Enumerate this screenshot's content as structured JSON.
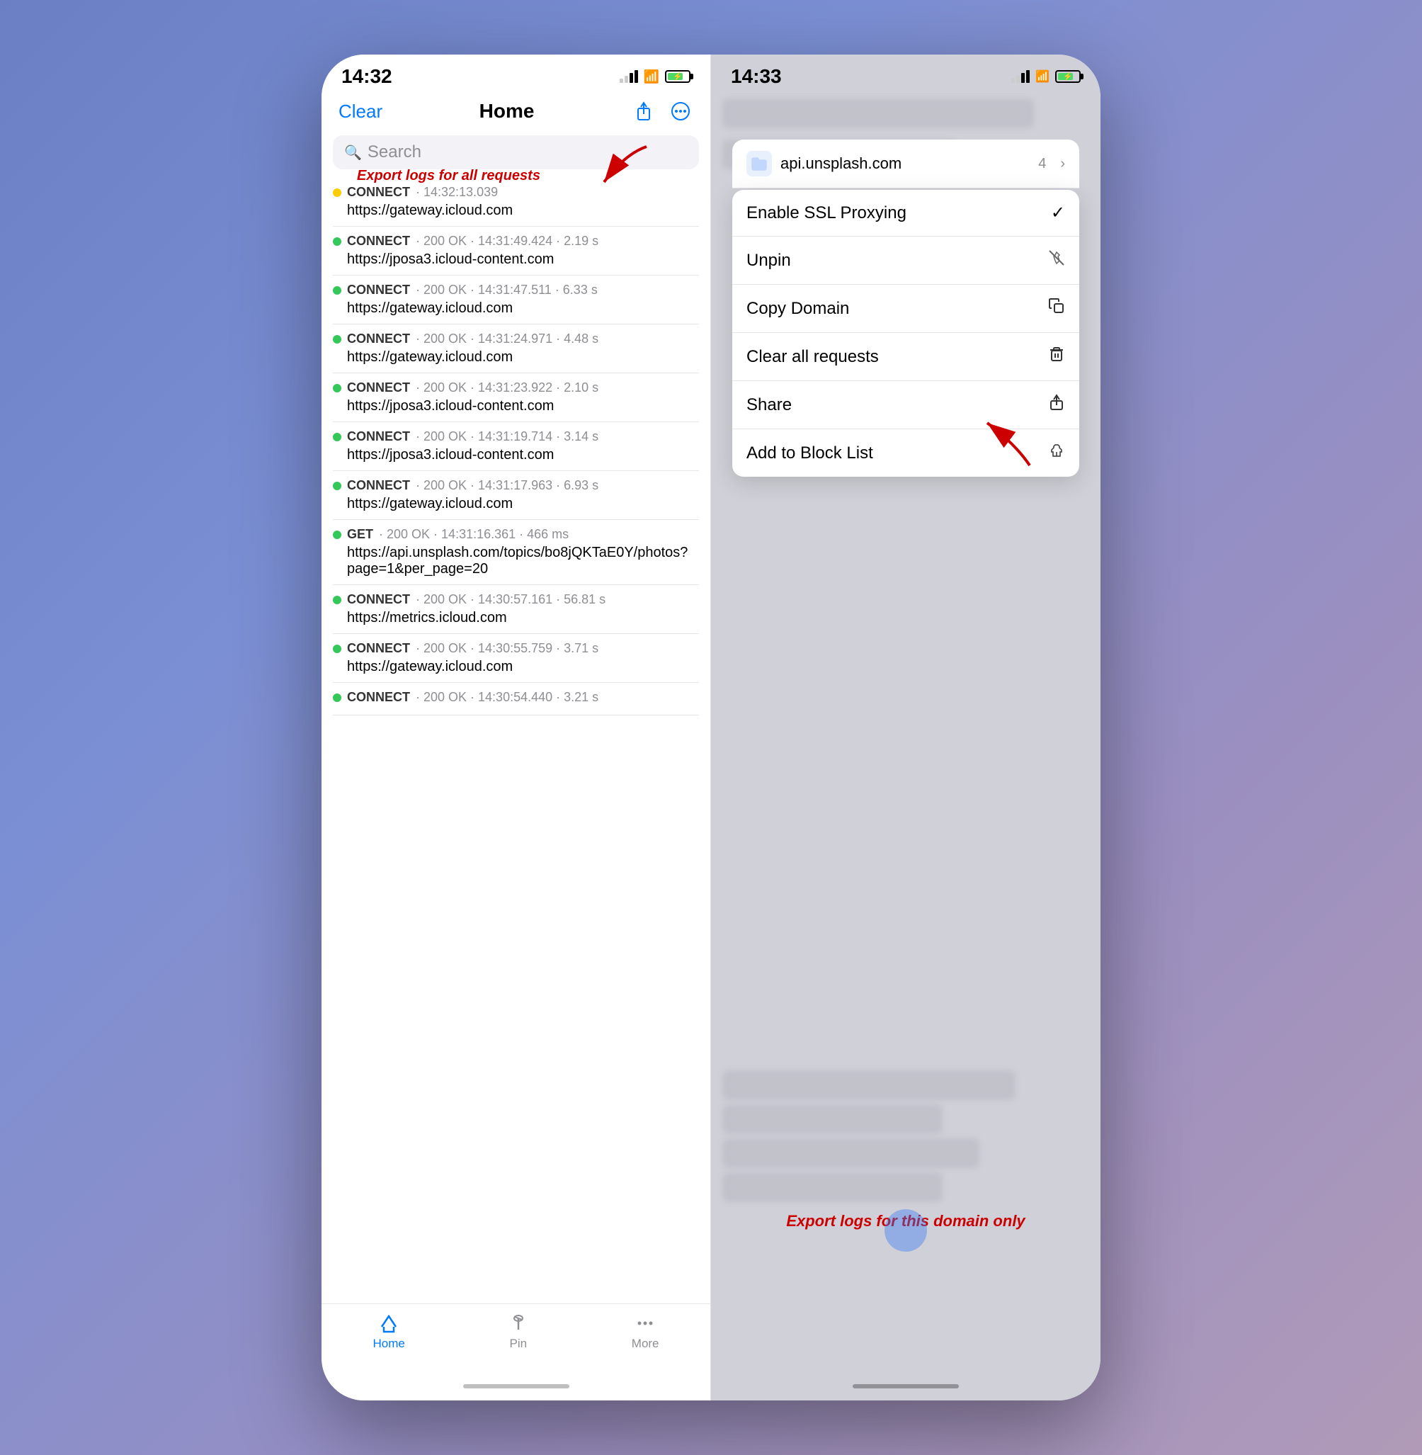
{
  "left": {
    "status": {
      "time": "14:32",
      "signal_bars": [
        3,
        4,
        3,
        2
      ],
      "battery_level": 75
    },
    "nav": {
      "clear_label": "Clear",
      "title": "Home",
      "share_tooltip": "Share",
      "more_tooltip": "More"
    },
    "search": {
      "placeholder": "Search"
    },
    "requests": [
      {
        "dot": "yellow",
        "method": "CONNECT",
        "meta": "14:32:13.039",
        "url": "https://gateway.icloud.com"
      },
      {
        "dot": "green",
        "method": "CONNECT",
        "meta": "200 OK · 14:31:49.424 · 2.19 s",
        "url": "https://jposa3.icloud-content.com"
      },
      {
        "dot": "green",
        "method": "CONNECT",
        "meta": "200 OK · 14:31:47.511 · 6.33 s",
        "url": "https://gateway.icloud.com"
      },
      {
        "dot": "green",
        "method": "CONNECT",
        "meta": "200 OK · 14:31:24.971 · 4.48 s",
        "url": "https://gateway.icloud.com"
      },
      {
        "dot": "green",
        "method": "CONNECT",
        "meta": "200 OK · 14:31:23.922 · 2.10 s",
        "url": "https://jposa3.icloud-content.com"
      },
      {
        "dot": "green",
        "method": "CONNECT",
        "meta": "200 OK · 14:31:19.714 · 3.14 s",
        "url": "https://jposa3.icloud-content.com"
      },
      {
        "dot": "green",
        "method": "CONNECT",
        "meta": "200 OK · 14:31:17.963 · 6.93 s",
        "url": "https://gateway.icloud.com"
      },
      {
        "dot": "green",
        "method": "GET",
        "meta": "200 OK · 14:31:16.361 · 466 ms",
        "url": "https://api.unsplash.com/topics/bo8jQKTaE0Y/photos?page=1&per_page=20"
      },
      {
        "dot": "green",
        "method": "CONNECT",
        "meta": "200 OK · 14:30:57.161 · 56.81 s",
        "url": "https://metrics.icloud.com"
      },
      {
        "dot": "green",
        "method": "CONNECT",
        "meta": "200 OK · 14:30:55.759 · 3.71 s",
        "url": "https://gateway.icloud.com"
      },
      {
        "dot": "green",
        "method": "CONNECT",
        "meta": "200 OK · 14:30:54.440 · 3.21 s",
        "url": ""
      }
    ],
    "annotation": "Export logs for all  requests",
    "tabs": [
      {
        "icon": "✈",
        "label": "Home",
        "active": true
      },
      {
        "icon": "📌",
        "label": "Pin",
        "active": false
      },
      {
        "icon": "•••",
        "label": "More",
        "active": false
      }
    ]
  },
  "right": {
    "status": {
      "time": "14:33"
    },
    "domain": {
      "name": "api.unsplash.com",
      "count": "4",
      "icon": "📁"
    },
    "menu_items": [
      {
        "label": "Enable SSL Proxying",
        "icon": "✓",
        "id": "ssl-proxying"
      },
      {
        "label": "Unpin",
        "icon": "⌦",
        "id": "unpin"
      },
      {
        "label": "Copy Domain",
        "icon": "⧉",
        "id": "copy-domain"
      },
      {
        "label": "Clear all requests",
        "icon": "🗑",
        "id": "clear-requests"
      },
      {
        "label": "Share",
        "icon": "↑",
        "id": "share"
      },
      {
        "label": "Add to Block List",
        "icon": "🖐",
        "id": "block-list"
      }
    ],
    "annotation": "Export logs for this domain only"
  }
}
